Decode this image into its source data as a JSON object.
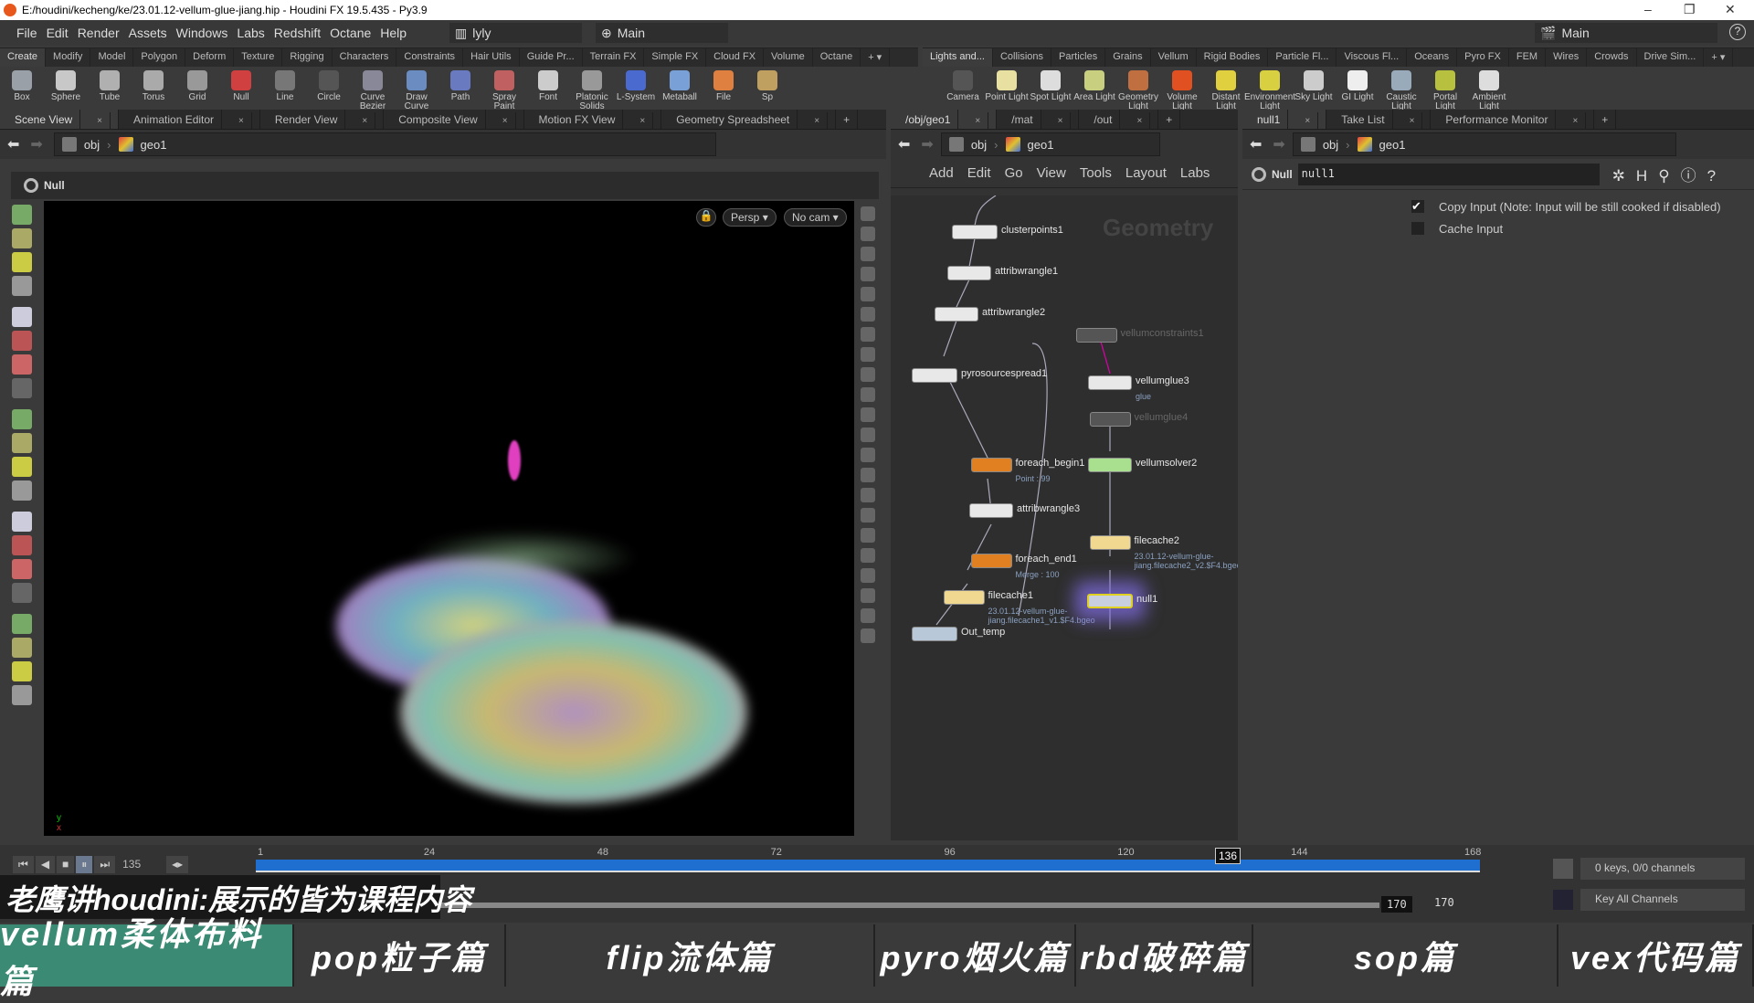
{
  "window": {
    "title": "E:/houdini/kecheng/ke/23.01.12-vellum-glue-jiang.hip - Houdini FX 19.5.435 - Py3.9",
    "minimize": "–",
    "restore": "❐",
    "close": "✕"
  },
  "menu": {
    "items": [
      "File",
      "Edit",
      "Render",
      "Assets",
      "Windows",
      "Labs",
      "Redshift",
      "Octane",
      "Help"
    ],
    "desktop": "lyly",
    "context": "Main",
    "right_context": "Main",
    "help": "?"
  },
  "shelf_left": {
    "tabs": [
      "Create",
      "Modify",
      "Model",
      "Polygon",
      "Deform",
      "Texture",
      "Rigging",
      "Characters",
      "Constraints",
      "Hair Utils",
      "Guide Pr...",
      "Terrain FX",
      "Simple FX",
      "Cloud FX",
      "Volume",
      "Octane"
    ],
    "tools": [
      {
        "label": "Box",
        "color": "#9aa0a8"
      },
      {
        "label": "Sphere",
        "color": "#c8c8c8"
      },
      {
        "label": "Tube",
        "color": "#b0b0b0"
      },
      {
        "label": "Torus",
        "color": "#aaa"
      },
      {
        "label": "Grid",
        "color": "#999"
      },
      {
        "label": "Null",
        "color": "#d04040"
      },
      {
        "label": "Line",
        "color": "#777"
      },
      {
        "label": "Circle",
        "color": "#555"
      },
      {
        "label": "Curve Bezier",
        "color": "#889"
      },
      {
        "label": "Draw Curve",
        "color": "#6a8cc0"
      },
      {
        "label": "Path",
        "color": "#6a7ac0"
      },
      {
        "label": "Spray Paint",
        "color": "#c06060"
      },
      {
        "label": "Font",
        "color": "#ccc"
      },
      {
        "label": "Platonic Solids",
        "color": "#999"
      },
      {
        "label": "L-System",
        "color": "#4a6ad0"
      },
      {
        "label": "Metaball",
        "color": "#7aa0d8"
      },
      {
        "label": "File",
        "color": "#e08040"
      },
      {
        "label": "Sp",
        "color": "#c0a060"
      }
    ]
  },
  "shelf_right": {
    "tabs": [
      "Lights and...",
      "Collisions",
      "Particles",
      "Grains",
      "Vellum",
      "Rigid Bodies",
      "Particle Fl...",
      "Viscous Fl...",
      "Oceans",
      "Pyro FX",
      "FEM",
      "Wires",
      "Crowds",
      "Drive Sim..."
    ],
    "tools": [
      {
        "label": "Camera",
        "color": "#555"
      },
      {
        "label": "Point Light",
        "color": "#e8e0a0"
      },
      {
        "label": "Spot Light",
        "color": "#ddd"
      },
      {
        "label": "Area Light",
        "color": "#c8d080"
      },
      {
        "label": "Geometry Light",
        "color": "#c07040"
      },
      {
        "label": "Volume Light",
        "color": "#e05020"
      },
      {
        "label": "Distant Light",
        "color": "#e0d040"
      },
      {
        "label": "Environment Light",
        "color": "#d8d040"
      },
      {
        "label": "Sky Light",
        "color": "#ccc"
      },
      {
        "label": "GI Light",
        "color": "#eee"
      },
      {
        "label": "Caustic Light",
        "color": "#9ab"
      },
      {
        "label": "Portal Light",
        "color": "#b8c040"
      },
      {
        "label": "Ambient Light",
        "color": "#ddd"
      }
    ]
  },
  "scene_pane": {
    "tabs": [
      "Scene View",
      "Animation Editor",
      "Render View",
      "Composite View",
      "Motion FX View",
      "Geometry Spreadsheet"
    ],
    "path": [
      "obj",
      "geo1"
    ],
    "node_type": "Null",
    "persp": "Persp",
    "cam": "No cam"
  },
  "network_pane": {
    "tabs": [
      "/obj/geo1",
      "/mat",
      "/out"
    ],
    "path": [
      "obj",
      "geo1"
    ],
    "menu": [
      "Add",
      "Edit",
      "Go",
      "View",
      "Tools",
      "Layout",
      "Labs"
    ],
    "watermark": "Geometry",
    "nodes": [
      {
        "name": "clusterpoints1",
        "color": "#e8e8e8"
      },
      {
        "name": "attribwrangle1",
        "color": "#e8e8e8"
      },
      {
        "name": "attribwrangle2",
        "color": "#e8e8e8"
      },
      {
        "name": "vellumconstraints1",
        "color": "#555"
      },
      {
        "name": "vellumglue3",
        "color": "#e8e8e8",
        "sub": "glue"
      },
      {
        "name": "vellumglue4",
        "color": "#555"
      },
      {
        "name": "pyrosourcespread1",
        "color": "#e8e8e8"
      },
      {
        "name": "foreach_begin1",
        "color": "#e08020",
        "sub": "Point : 99"
      },
      {
        "name": "vellumsolver2",
        "color": "#a8e090"
      },
      {
        "name": "attribwrangle3",
        "color": "#e8e8e8"
      },
      {
        "name": "foreach_end1",
        "color": "#e08020",
        "sub": "Merge : 100"
      },
      {
        "name": "filecache2",
        "color": "#f0d890",
        "sub": "23.01.12-vellum-glue-jiang.filecache2_v2.$F4.bgeo"
      },
      {
        "name": "filecache1",
        "color": "#f0d890",
        "sub": "23.01.12-vellum-glue-jiang.filecache1_v1.$F4.bgeo"
      },
      {
        "name": "null1",
        "color": "#c8d0e0"
      },
      {
        "name": "Out_temp",
        "color": "#b8c8d8"
      }
    ]
  },
  "param_pane": {
    "tabs": [
      "null1",
      "Take List",
      "Performance Monitor"
    ],
    "path": [
      "obj",
      "geo1"
    ],
    "node_type": "Null",
    "node_name": "null1",
    "params": [
      {
        "label": "Copy Input (Note: Input will be still cooked if disabled)",
        "checked": true
      },
      {
        "label": "Cache Input",
        "checked": false
      }
    ]
  },
  "timeline": {
    "current_frame": "135",
    "marker": "136",
    "ticks": [
      "1",
      "24",
      "48",
      "72",
      "96",
      "120",
      "144",
      "168"
    ],
    "end1": "170",
    "end2": "170",
    "keys": "0 keys, 0/0 channels",
    "key_mode": "Key All Channels",
    "accent": "#1e6fd0"
  },
  "overlay": {
    "caption": "老鹰讲houdini:展示的皆为课程内容",
    "banners": [
      "vellum柔体布料篇",
      "pop粒子篇",
      "flip流体篇",
      "pyro烟火篇",
      "rbd破碎篇",
      "sop篇",
      "vex代码篇"
    ],
    "active_color": "#3a8a74"
  }
}
